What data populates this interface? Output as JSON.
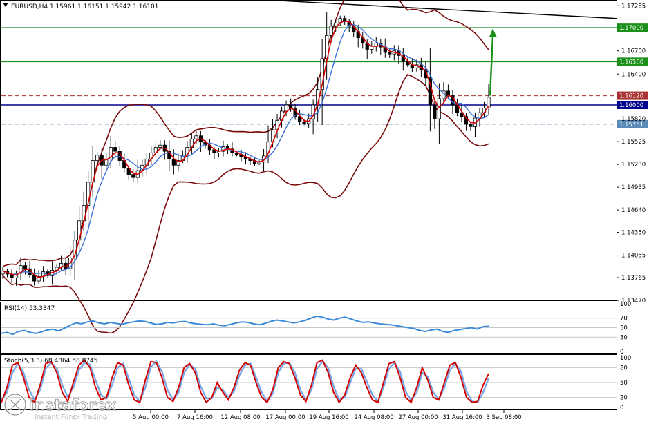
{
  "header": {
    "symbol_line": "EURUSD,H4  1.15961 1.16151 1.15942 1.16101",
    "rsi_label": "RSI(14) 53.3347",
    "stoch_label": "Stoch(5,3,3) 68.4864 58.8745"
  },
  "colors": {
    "frame": "#000000",
    "bull_candle": "#ffffff",
    "bear_candle": "#000000",
    "bands": "#7a0a0a",
    "ma_fast": "#d40000",
    "ma_slow": "#3a6fd8",
    "support_line": "#00008b",
    "resistance_line": "#1a8f1a",
    "dashed_red": "#a33",
    "dashed_blue": "#5a8ab8",
    "arrow": "#1a8f1a",
    "rsi_line": "#3a8ad8",
    "stoch_main": "#d40000",
    "stoch_signal": "#7aa6e6"
  },
  "chart_data": [
    {
      "type": "candlestick",
      "symbol": "EURUSD",
      "timeframe": "H4",
      "ohlc_last": {
        "open": 1.15961,
        "high": 1.16151,
        "low": 1.15942,
        "close": 1.16101
      },
      "y_ticks": [
        "1.17285",
        "1.16700",
        "1.16400",
        "1.15525",
        "1.15230",
        "1.14935",
        "1.14640",
        "1.14350",
        "1.14055",
        "1.13765",
        "1.13470"
      ],
      "ylim": [
        1.1347,
        1.1735
      ],
      "x_ticks": [
        "5 Aug 00:00",
        "7 Aug 16:00",
        "12 Aug 08:00",
        "17 Aug 00:00",
        "19 Aug 16:00",
        "24 Aug 08:00",
        "27 Aug 00:00",
        "31 Aug 16:00",
        "3 Sep 08:00"
      ],
      "horizontal_levels": [
        {
          "value": 1.17,
          "label": "1.17000",
          "style": "solid",
          "color": "green"
        },
        {
          "value": 1.1656,
          "label": "1.16560",
          "style": "solid",
          "color": "green"
        },
        {
          "value": 1.1612,
          "label": "1.16120",
          "style": "dashed",
          "color": "red"
        },
        {
          "value": 1.16,
          "label": "1.16000",
          "style": "solid",
          "color": "blue"
        },
        {
          "value": 1.15751,
          "label": "1.15751",
          "style": "dashed",
          "color": "blue"
        },
        {
          "value": 1.1582,
          "label": "1.15820",
          "style": "hidden"
        }
      ],
      "trendline": {
        "from": 1.1742,
        "to": 1.1712
      },
      "arrow": {
        "from": 1.1612,
        "to": 1.1699,
        "direction": "up"
      },
      "close_series": [
        1.1385,
        1.1381,
        1.1376,
        1.1382,
        1.1392,
        1.1388,
        1.138,
        1.1372,
        1.1378,
        1.1384,
        1.1379,
        1.1386,
        1.139,
        1.1395,
        1.1388,
        1.1402,
        1.1425,
        1.145,
        1.147,
        1.15,
        1.1528,
        1.1535,
        1.1522,
        1.153,
        1.1545,
        1.154,
        1.1528,
        1.1518,
        1.151,
        1.1506,
        1.1515,
        1.1522,
        1.153,
        1.1538,
        1.1545,
        1.1548,
        1.154,
        1.153,
        1.1522,
        1.1528,
        1.1534,
        1.1545,
        1.1556,
        1.156,
        1.1552,
        1.1548,
        1.1542,
        1.1538,
        1.154,
        1.1546,
        1.1543,
        1.1538,
        1.1536,
        1.1533,
        1.153,
        1.1528,
        1.1524,
        1.1526,
        1.1534,
        1.1552,
        1.1568,
        1.158,
        1.1592,
        1.16,
        1.1595,
        1.1585,
        1.1578,
        1.1576,
        1.1582,
        1.16,
        1.162,
        1.166,
        1.169,
        1.1702,
        1.1706,
        1.1712,
        1.1708,
        1.1702,
        1.1695,
        1.1687,
        1.168,
        1.1672,
        1.1676,
        1.168,
        1.1675,
        1.1668,
        1.1666,
        1.167,
        1.1664,
        1.1656,
        1.1652,
        1.1648,
        1.1652,
        1.1646,
        1.1635,
        1.16,
        1.1582,
        1.1608,
        1.1618,
        1.1612,
        1.16,
        1.159,
        1.1585,
        1.1575,
        1.1572,
        1.1583,
        1.159,
        1.1596,
        1.161
      ],
      "rsi": {
        "name": "RSI(14)",
        "value": 53.3347,
        "levels": [
          70,
          50,
          30
        ],
        "scale": [
          "100",
          "70",
          "50",
          "30",
          "0"
        ],
        "series": [
          38,
          40,
          36,
          42,
          44,
          40,
          38,
          41,
          45,
          47,
          43,
          49,
          55,
          60,
          58,
          62,
          64,
          60,
          58,
          61,
          59,
          57,
          60,
          62,
          64,
          63,
          60,
          57,
          58,
          61,
          60,
          62,
          63,
          60,
          58,
          57,
          56,
          58,
          55,
          54,
          57,
          60,
          62,
          61,
          58,
          56,
          59,
          63,
          66,
          64,
          62,
          60,
          62,
          65,
          70,
          74,
          72,
          68,
          66,
          70,
          72,
          68,
          64,
          61,
          62,
          60,
          58,
          57,
          56,
          54,
          52,
          50,
          48,
          44,
          42,
          45,
          47,
          42,
          40,
          44,
          46,
          48,
          50,
          47,
          52,
          53
        ]
      },
      "stoch": {
        "name": "Stoch(5,3,3)",
        "main": 68.4864,
        "signal": 58.8745,
        "levels": [
          80,
          50,
          20
        ],
        "scale": [
          "100",
          "80",
          "50",
          "20",
          "0"
        ],
        "main_series": [
          10,
          40,
          85,
          90,
          60,
          20,
          10,
          45,
          88,
          92,
          70,
          30,
          12,
          50,
          85,
          95,
          80,
          40,
          15,
          20,
          60,
          90,
          85,
          45,
          15,
          10,
          55,
          92,
          90,
          60,
          20,
          12,
          40,
          80,
          88,
          70,
          30,
          10,
          20,
          50,
          30,
          15,
          40,
          75,
          90,
          85,
          50,
          20,
          10,
          35,
          80,
          92,
          88,
          60,
          25,
          12,
          45,
          90,
          95,
          70,
          30,
          10,
          25,
          60,
          85,
          70,
          40,
          15,
          10,
          50,
          88,
          92,
          60,
          20,
          10,
          40,
          80,
          55,
          20,
          15,
          50,
          85,
          90,
          60,
          20,
          10,
          12,
          45,
          68
        ],
        "signal_series": [
          15,
          30,
          70,
          88,
          70,
          35,
          15,
          35,
          78,
          90,
          78,
          45,
          20,
          40,
          75,
          90,
          86,
          55,
          25,
          18,
          45,
          80,
          88,
          58,
          25,
          12,
          40,
          82,
          92,
          72,
          35,
          15,
          30,
          70,
          86,
          78,
          42,
          18,
          18,
          40,
          35,
          20,
          32,
          65,
          85,
          88,
          60,
          30,
          12,
          28,
          70,
          88,
          90,
          70,
          35,
          15,
          35,
          78,
          92,
          80,
          42,
          15,
          20,
          50,
          78,
          78,
          52,
          25,
          12,
          40,
          78,
          90,
          72,
          32,
          14,
          30,
          70,
          62,
          30,
          16,
          40,
          75,
          88,
          72,
          32,
          12,
          10,
          30,
          59
        ]
      }
    }
  ],
  "watermark": {
    "brand": "instaforex",
    "tagline": "Instant Forex Trading"
  }
}
